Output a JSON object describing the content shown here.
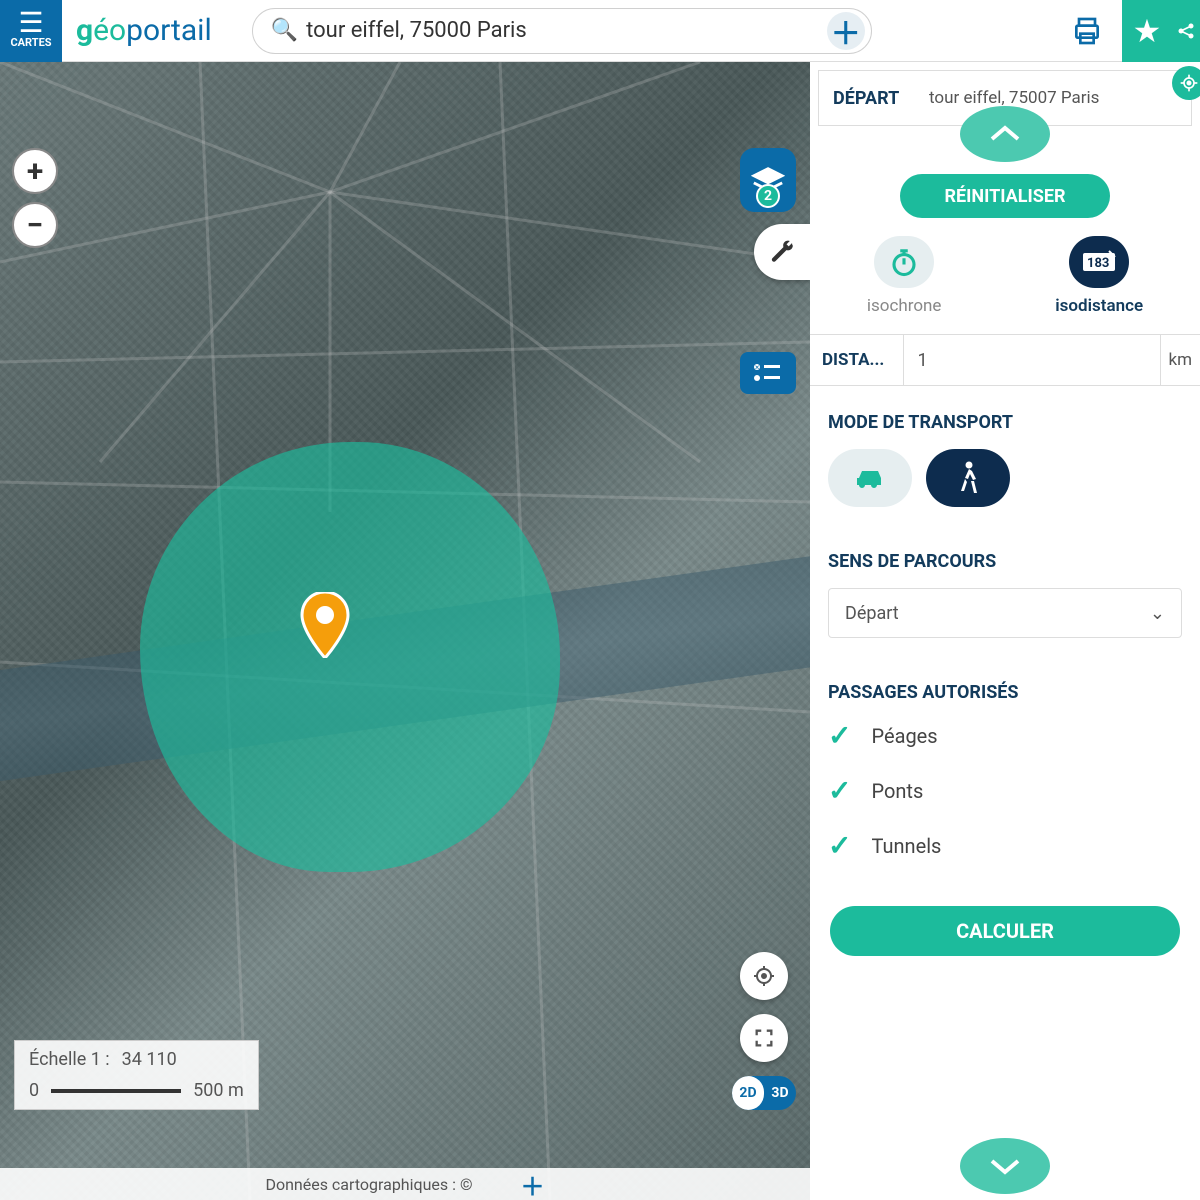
{
  "header": {
    "menu_label": "CARTES",
    "logo": {
      "g": "g",
      "eo": "éo",
      "portail": "portail"
    },
    "search_value": "tour eiffel, 75000 Paris"
  },
  "map": {
    "layers_count": "2",
    "scale": {
      "label": "Échelle 1 :",
      "value": "34 110",
      "zero": "0",
      "dist": "500 m"
    },
    "dim": {
      "d2": "2D",
      "d3": "3D"
    },
    "attribution": "Données cartographiques : ©"
  },
  "panel": {
    "depart": {
      "label": "DÉPART",
      "value": "tour eiffel, 75007 Paris"
    },
    "reset": "RÉINITIALISER",
    "iso": {
      "chrone": "isochrone",
      "distance": "isodistance",
      "dist_label": "DISTA...",
      "dist_value": "1",
      "unit": "km"
    },
    "transport": {
      "title": "MODE DE TRANSPORT"
    },
    "sens": {
      "title": "SENS DE PARCOURS",
      "value": "Départ"
    },
    "passages": {
      "title": "PASSAGES AUTORISÉS",
      "items": [
        "Péages",
        "Ponts",
        "Tunnels"
      ]
    },
    "calc": "CALCULER"
  }
}
